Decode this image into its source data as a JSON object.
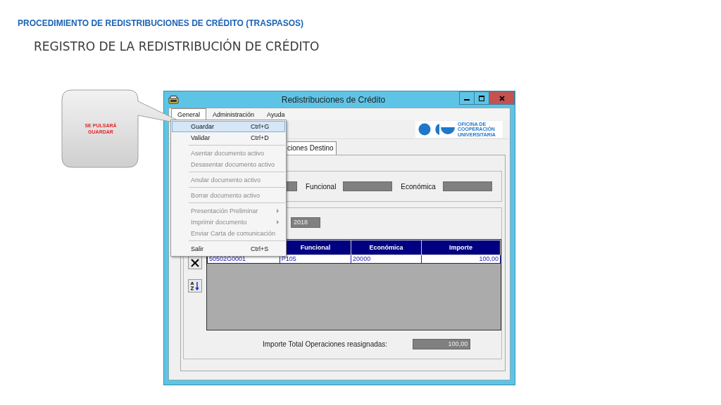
{
  "slide": {
    "heading": "PROCEDIMIENTO DE REDISTRIBUCIONES DE CRÉDITO (TRASPASOS)",
    "subheading": "REGISTRO DE LA REDISTRIBUCIÓN DE CRÉDITO"
  },
  "callout": {
    "text": "SE PULSARÁ GUARDAR"
  },
  "window": {
    "title": "Redistribuciones de Crédito"
  },
  "menu_bar": [
    {
      "label": "General",
      "selected": true
    },
    {
      "label": "Administración",
      "selected": false
    },
    {
      "label": "Ayuda",
      "selected": false
    }
  ],
  "menu": [
    {
      "kind": "item",
      "label": "Guardar",
      "shortcut": "Ctrl+G",
      "disabled": false,
      "selected": true,
      "submenu": false
    },
    {
      "kind": "item",
      "label": "Validar",
      "shortcut": "Ctrl+D",
      "disabled": false,
      "selected": false,
      "submenu": false
    },
    {
      "kind": "separator"
    },
    {
      "kind": "item",
      "label": "Asentar documento activo",
      "disabled": true,
      "selected": false,
      "submenu": false
    },
    {
      "kind": "item",
      "label": "Desasentar documento activo",
      "disabled": true,
      "selected": false,
      "submenu": false
    },
    {
      "kind": "separator"
    },
    {
      "kind": "item",
      "label": "Anular documento activo",
      "disabled": true,
      "selected": false,
      "submenu": false
    },
    {
      "kind": "separator"
    },
    {
      "kind": "item",
      "label": "Borrar documento activo",
      "disabled": true,
      "selected": false,
      "submenu": false
    },
    {
      "kind": "separator"
    },
    {
      "kind": "item",
      "label": "Presentación Preliminar",
      "disabled": true,
      "selected": false,
      "submenu": true
    },
    {
      "kind": "item",
      "label": "Imprimir documento",
      "disabled": true,
      "selected": false,
      "submenu": true
    },
    {
      "kind": "item",
      "label": "Enviar Carta de comunicación",
      "disabled": true,
      "selected": false,
      "submenu": false
    },
    {
      "kind": "separator"
    },
    {
      "kind": "item",
      "label": "Salir",
      "shortcut": "Ctrl+S",
      "disabled": false,
      "selected": false,
      "submenu": false
    }
  ],
  "logo": {
    "lines": [
      "OFICINA DE",
      "COOPERACIÓN",
      "UNIVERSITARIA"
    ]
  },
  "tabs": [
    {
      "label": "ciones Destino",
      "selected": true
    }
  ],
  "filters": [
    {
      "label": "Funcional"
    },
    {
      "label": "Económica"
    }
  ],
  "year_field": {
    "value": "2018"
  },
  "grid": {
    "columns": [
      "",
      "Funcional",
      "Económica",
      "Importe"
    ],
    "rows": [
      [
        "50502G0001",
        "P105",
        "20000",
        "100,00"
      ]
    ]
  },
  "total": {
    "label": "Importe Total Operaciones reasignadas:",
    "value": "100,00"
  }
}
